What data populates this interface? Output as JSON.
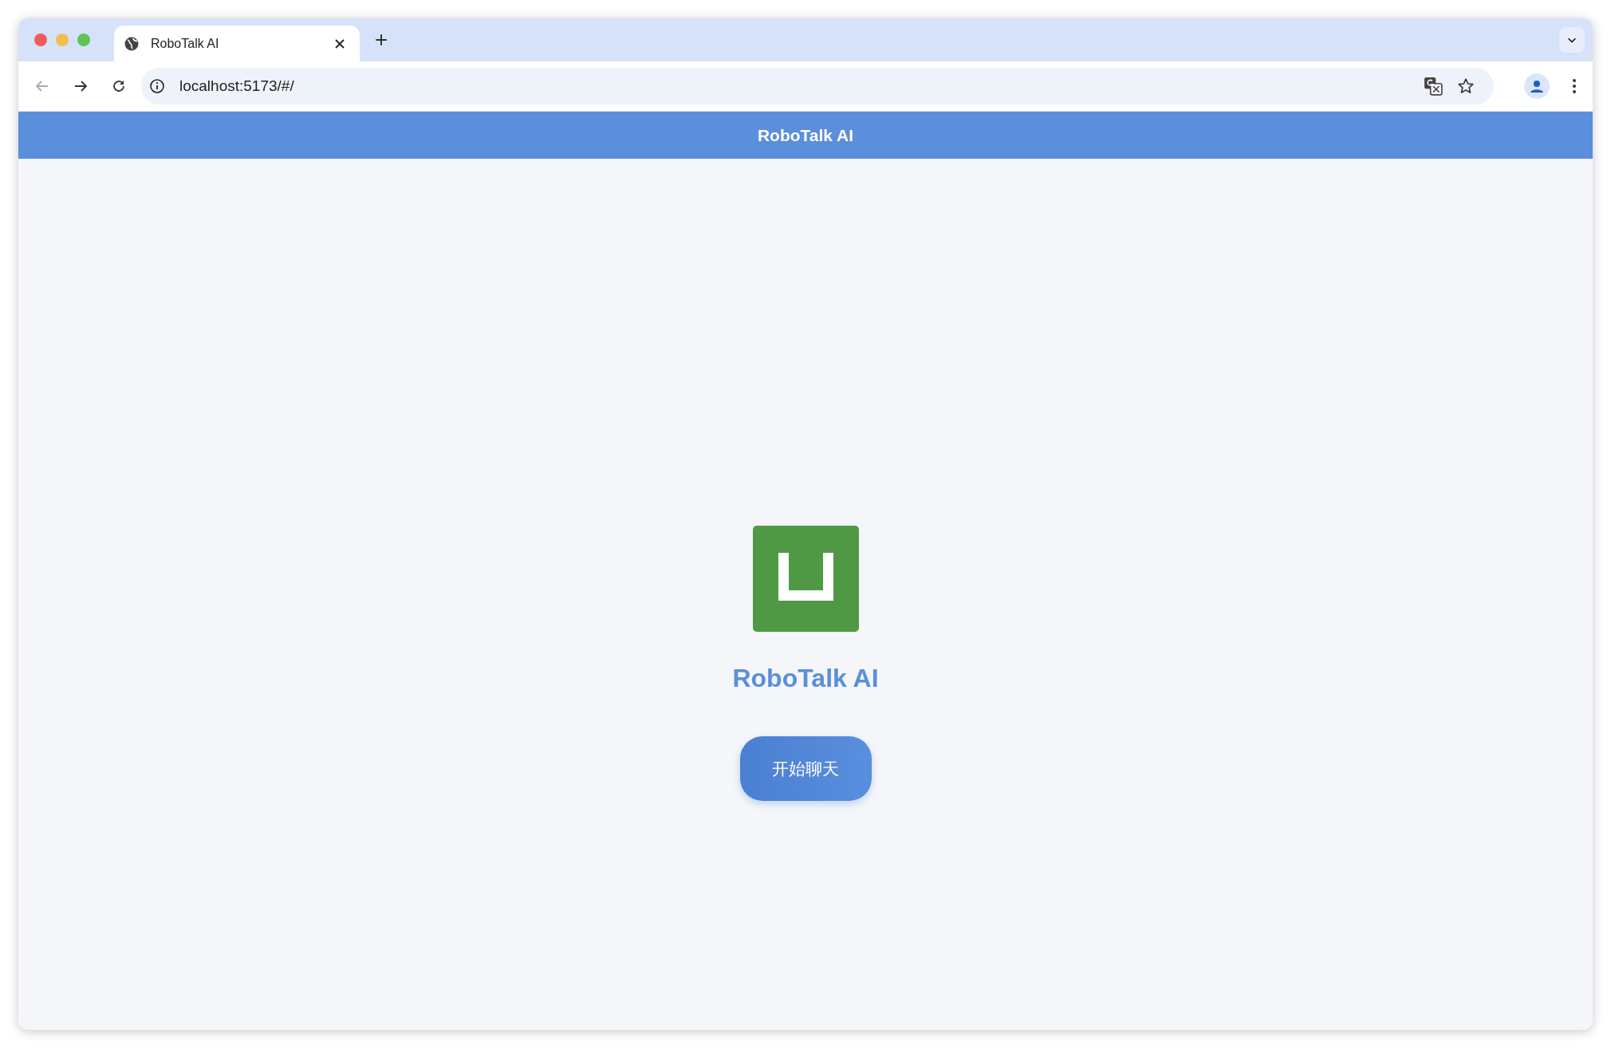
{
  "browser": {
    "tabs": [
      {
        "title": "RoboTalk AI",
        "selected": true
      }
    ],
    "address": "localhost:5173/#/"
  },
  "header": {
    "title": "RoboTalk AI"
  },
  "hero": {
    "title": "RoboTalk AI",
    "button": "开始聊天"
  }
}
